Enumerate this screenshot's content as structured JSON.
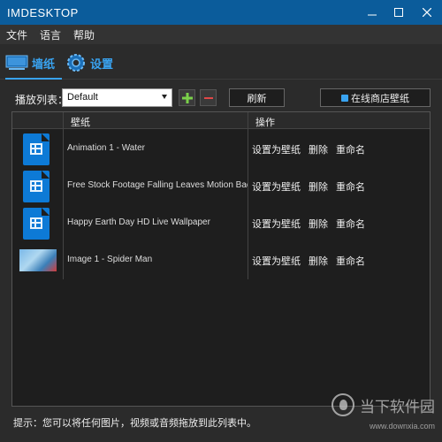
{
  "window": {
    "title": "IMDESKTOP"
  },
  "menu": {
    "items": [
      "文件",
      "语言",
      "帮助"
    ]
  },
  "tabs": [
    {
      "label": "墙纸",
      "icon": "monitor-icon",
      "active": true
    },
    {
      "label": "设置",
      "icon": "gear-icon",
      "active": false
    }
  ],
  "toolbar": {
    "playlist_label": "播放列表：",
    "playlist_selected": "Default",
    "refresh_label": "刷新",
    "store_label": "在线商店壁纸"
  },
  "list": {
    "columns": [
      "壁纸",
      "操作"
    ],
    "rows": [
      {
        "name": "Animation 1 - Water",
        "type": "video"
      },
      {
        "name": "Free Stock Footage Falling Leaves Motion Backg",
        "type": "video"
      },
      {
        "name": "Happy Earth Day HD Live Wallpaper",
        "type": "video"
      },
      {
        "name": "Image 1 - Spider Man",
        "type": "image"
      }
    ],
    "actions": [
      "设置为壁纸",
      "删除",
      "重命名"
    ]
  },
  "footer": {
    "hint": "提示：您可以将任何图片，视频或音频拖放到此列表中。"
  },
  "watermark": {
    "text": "当下软件园",
    "url": "www.downxia.com"
  },
  "colors": {
    "titlebar": "#0b5c9b",
    "accent": "#39a3f0",
    "background": "#2b2b2b"
  }
}
